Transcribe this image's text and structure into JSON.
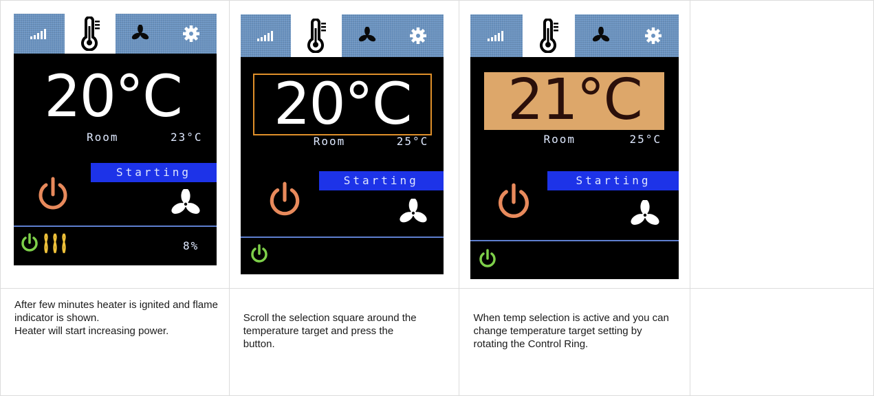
{
  "icons": {
    "tabs": [
      "signal-icon",
      "thermometer-icon",
      "fan-icon",
      "gear-icon"
    ],
    "main_power": "power-icon",
    "fan": "fan-icon",
    "bottom_power": "power-icon",
    "flame": "flame-icon"
  },
  "colors": {
    "tab_bar": "#6b94c2",
    "status_bar": "#1d33e8",
    "selection_frame": "#e0902a",
    "selection_fill": "#dda76a",
    "main_power_icon": "#e88a5c",
    "bottom_power_icon": "#7ed04a",
    "flame_icon": "#f0c23a"
  },
  "panels": [
    {
      "screen": {
        "target_temp": "20°C",
        "room_label": "Room",
        "room_temp": "23°C",
        "status": "Starting",
        "power_percent": "8%"
      },
      "caption": [
        "After few minutes heater is ignited and flame indicator is shown.",
        "Heater will start increasing power."
      ]
    },
    {
      "screen": {
        "target_temp": "20°C",
        "room_label": "Room",
        "room_temp": "25°C",
        "status": "Starting"
      },
      "caption": [
        "Scroll the selection square around the temperature target and press the button."
      ]
    },
    {
      "screen": {
        "target_temp": "21°C",
        "room_label": "Room",
        "room_temp": "25°C",
        "status": "Starting"
      },
      "caption": [
        "When temp selection is active and you can change temperature target setting by rotating the Control Ring."
      ]
    }
  ]
}
